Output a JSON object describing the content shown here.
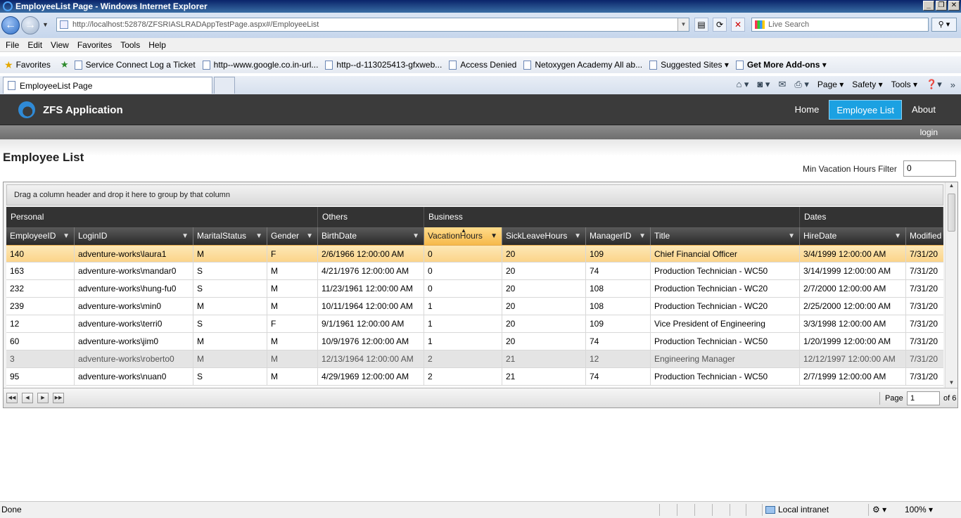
{
  "window": {
    "title": "EmployeeList Page - Windows Internet Explorer",
    "url": "http://localhost:52878/ZFSRIASLRADAppTestPage.aspx#/EmployeeList",
    "search_placeholder": "Live Search"
  },
  "menu": [
    "File",
    "Edit",
    "View",
    "Favorites",
    "Tools",
    "Help"
  ],
  "favorites": {
    "label": "Favorites",
    "links": [
      "Service Connect  Log a Ticket",
      "http--www.google.co.in-url...",
      "http--d-113025413-gfxweb...",
      "Access Denied",
      "Netoxygen Academy  All ab...",
      "Suggested Sites ▾",
      "Get More Add-ons ▾"
    ]
  },
  "tab": {
    "title": "EmployeeList Page"
  },
  "command_bar": {
    "page": "Page ▾",
    "safety": "Safety ▾",
    "tools": "Tools ▾"
  },
  "app": {
    "name": "ZFS Application",
    "nav": [
      "Home",
      "Employee List",
      "About"
    ],
    "active_nav": "Employee List",
    "login": "login",
    "page_title": "Employee List",
    "filter_label": "Min Vacation Hours Filter",
    "filter_value": "0"
  },
  "grid": {
    "group_panel": "Drag a column header and drop it here to group by that column",
    "column_groups": [
      "Personal",
      "Others",
      "Business",
      "Dates"
    ],
    "columns": [
      "EmployeeID",
      "LoginID",
      "MaritalStatus",
      "Gender",
      "BirthDate",
      "VacationHours",
      "SickLeaveHours",
      "ManagerID",
      "Title",
      "HireDate",
      "Modified"
    ],
    "sorted_column": "VacationHours",
    "rows": [
      [
        "140",
        "adventure-works\\laura1",
        "M",
        "F",
        "2/6/1966 12:00:00 AM",
        "0",
        "20",
        "109",
        "Chief Financial Officer",
        "3/4/1999 12:00:00 AM",
        "7/31/20"
      ],
      [
        "163",
        "adventure-works\\mandar0",
        "S",
        "M",
        "4/21/1976 12:00:00 AM",
        "0",
        "20",
        "74",
        "Production Technician - WC50",
        "3/14/1999 12:00:00 AM",
        "7/31/20"
      ],
      [
        "232",
        "adventure-works\\hung-fu0",
        "S",
        "M",
        "11/23/1961 12:00:00 AM",
        "0",
        "20",
        "108",
        "Production Technician - WC20",
        "2/7/2000 12:00:00 AM",
        "7/31/20"
      ],
      [
        "239",
        "adventure-works\\min0",
        "M",
        "M",
        "10/11/1964 12:00:00 AM",
        "1",
        "20",
        "108",
        "Production Technician - WC20",
        "2/25/2000 12:00:00 AM",
        "7/31/20"
      ],
      [
        "12",
        "adventure-works\\terri0",
        "S",
        "F",
        "9/1/1961 12:00:00 AM",
        "1",
        "20",
        "109",
        "Vice President of Engineering",
        "3/3/1998 12:00:00 AM",
        "7/31/20"
      ],
      [
        "60",
        "adventure-works\\jim0",
        "M",
        "M",
        "10/9/1976 12:00:00 AM",
        "1",
        "20",
        "74",
        "Production Technician - WC50",
        "1/20/1999 12:00:00 AM",
        "7/31/20"
      ],
      [
        "3",
        "adventure-works\\roberto0",
        "M",
        "M",
        "12/13/1964 12:00:00 AM",
        "2",
        "21",
        "12",
        "Engineering Manager",
        "12/12/1997 12:00:00 AM",
        "7/31/20"
      ],
      [
        "95",
        "adventure-works\\nuan0",
        "S",
        "M",
        "4/29/1969 12:00:00 AM",
        "2",
        "21",
        "74",
        "Production Technician - WC50",
        "2/7/1999 12:00:00 AM",
        "7/31/20"
      ]
    ],
    "selected_row": 0,
    "disabled_row": 6
  },
  "pager": {
    "page_label": "Page",
    "page_value": "1",
    "of_label": "of 6"
  },
  "status": {
    "text": "Done",
    "zone": "Local intranet",
    "zoom": "100% ▾"
  }
}
